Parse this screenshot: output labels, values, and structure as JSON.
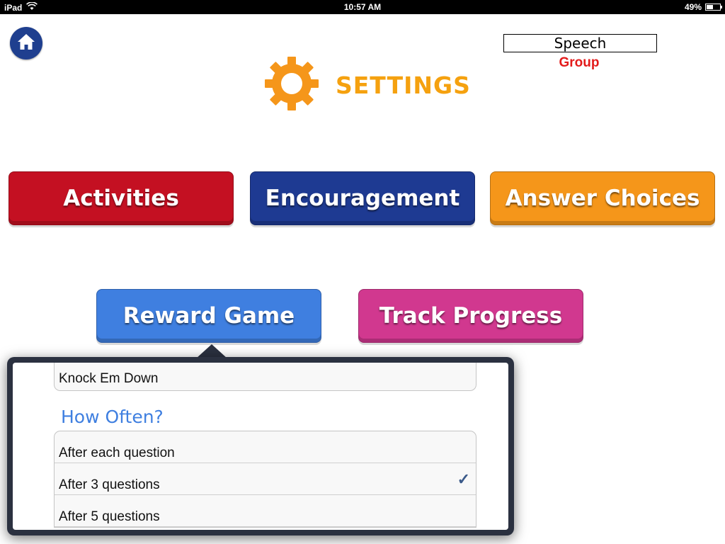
{
  "status_bar": {
    "device": "iPad",
    "time": "10:57 AM",
    "battery": "49%"
  },
  "header": {
    "title": "SETTINGS",
    "speech_field_value": "Speech",
    "group_label": "Group"
  },
  "buttons": {
    "activities": "Activities",
    "encouragement": "Encouragement",
    "answer_choices": "Answer Choices",
    "reward_game": "Reward Game",
    "track_progress": "Track Progress"
  },
  "popover": {
    "selected_game": "Knock Em Down",
    "section_heading": "How Often?",
    "options": [
      {
        "label": "After each question",
        "checked": false
      },
      {
        "label": "After 3 questions",
        "checked": true
      },
      {
        "label": "After 5 questions",
        "checked": false
      }
    ],
    "check_glyph": "✓"
  },
  "colors": {
    "settings_orange": "#f5a10f",
    "activities_red": "#c41022",
    "encouragement_blue": "#1e3a92",
    "answer_orange": "#f5961a",
    "reward_blue": "#3f7fe0",
    "track_pink": "#d1388f",
    "group_red": "#e31b1b"
  },
  "icons": {
    "home": "home-icon",
    "settings": "gear-icon",
    "wifi": "wifi-icon",
    "battery": "battery-icon",
    "checkmark": "checkmark-icon"
  }
}
